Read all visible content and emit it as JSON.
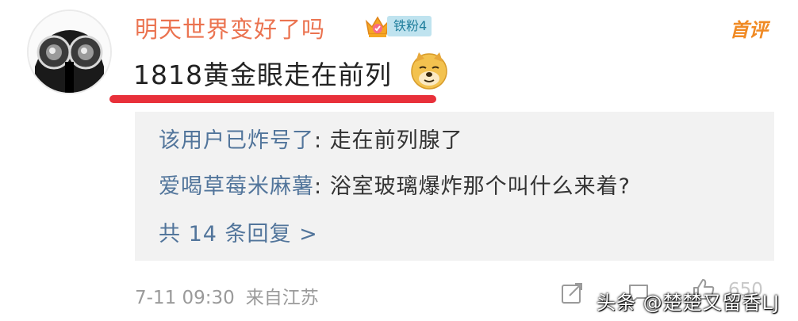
{
  "comment": {
    "username": "明天世界变好了吗",
    "badge_label": "铁粉4",
    "first_comment_tag": "首评",
    "text": "1818黄金眼走在前列",
    "emoji_icon": "doge-icon",
    "highlight_color": "#e8303a"
  },
  "replies": [
    {
      "user": "该用户已炸号了",
      "separator": ": ",
      "text": "走在前列腺了"
    },
    {
      "user": "爱喝草莓米麻薯",
      "separator": ": ",
      "text": "浴室玻璃爆炸那个叫什么来着?"
    }
  ],
  "more_replies": "共 14 条回复 >",
  "meta": {
    "time": "7-11 09:30",
    "source": "来自江苏"
  },
  "actions": {
    "share_icon": "share-icon",
    "comment_icon": "comment-icon",
    "like_icon": "thumbs-up-icon",
    "like_count": "650"
  },
  "watermark": "头条 @楚楚又留香LJ",
  "colors": {
    "username": "#eb7350",
    "link": "#52759b",
    "reply_bg": "#f2f2f2",
    "tag": "#f08a24"
  }
}
